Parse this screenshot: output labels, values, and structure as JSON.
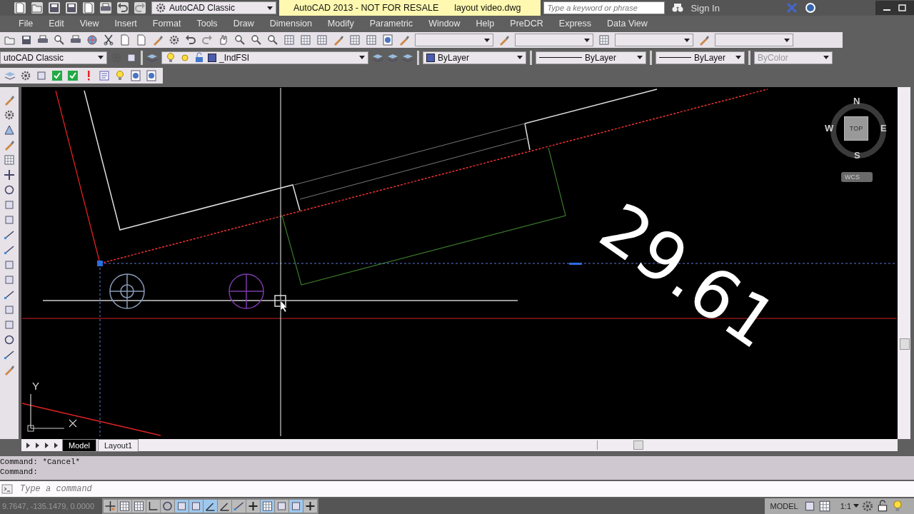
{
  "title_bar": {
    "workspace": "AutoCAD Classic",
    "title": "AutoCAD 2013 - NOT FOR RESALE",
    "filename": "layout video.dwg",
    "search": {
      "placeholder": "Type a keyword or phrase"
    },
    "sign_in": "Sign In"
  },
  "menu": [
    "File",
    "Edit",
    "View",
    "Insert",
    "Format",
    "Tools",
    "Draw",
    "Dimension",
    "Modify",
    "Parametric",
    "Window",
    "Help",
    "PreDCR",
    "Express",
    "Data View"
  ],
  "properties_toolbar": {
    "workspace": "utoCAD Classic",
    "layer": "_IndFSI",
    "color_value": "ByLayer",
    "linetype": "ByLayer",
    "lineweight": "ByLayer",
    "plot_style": {
      "value": "ByColor",
      "disabled": true
    }
  },
  "drawing": {
    "dimension_text": "29.61",
    "viewcube": {
      "north": "N",
      "south": "S",
      "east": "E",
      "west": "W",
      "face": "TOP",
      "ucs": "WCS"
    },
    "ucs_axis": "Y"
  },
  "layout_tabs": [
    {
      "label": "Model",
      "selected": true
    },
    {
      "label": "Layout1",
      "selected": false
    }
  ],
  "command_history": [
    "Command: *Cancel*",
    "Command:"
  ],
  "command_line": {
    "placeholder": "Type a command"
  },
  "status_bar": {
    "coordinates": "9.7647, -135.1479, 0.0000",
    "model": "MODEL",
    "scale": "1:1",
    "toggles": [
      {
        "on": false
      },
      {
        "on": false
      },
      {
        "on": false
      },
      {
        "on": false
      },
      {
        "on": false
      },
      {
        "on": true
      },
      {
        "on": true
      },
      {
        "on": true
      },
      {
        "on": false
      },
      {
        "on": false
      },
      {
        "on": false
      },
      {
        "on": true
      },
      {
        "on": false
      },
      {
        "on": true
      },
      {
        "on": false
      }
    ]
  }
}
